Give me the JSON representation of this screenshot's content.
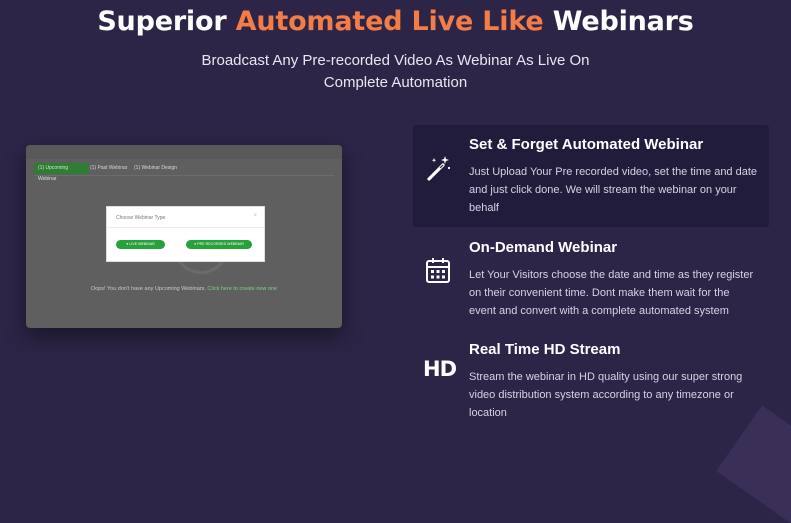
{
  "hero": {
    "title_part1": "Superior ",
    "title_accent": "Automated Live Like",
    "title_part2": " Webinars",
    "subtitle_line1": "Broadcast Any Pre-recorded Video As Webinar As Live On",
    "subtitle_line2": "Complete Automation",
    "accent_color": "#f47c46"
  },
  "preview": {
    "tabs": [
      "(1) Upcoming Webinar",
      "(1) Past Webinar",
      "(1) Webinar Design"
    ],
    "empty_message": "Oops! You don't have any Upcoming Webinars.",
    "empty_link": "Click here to create new one",
    "modal": {
      "title": "Choose Webinar Type",
      "close": "×",
      "buttons": [
        "LIVE WEBINAR",
        "PRE RECORDED WEBINAR"
      ]
    }
  },
  "features": [
    {
      "icon": "magic-wand-icon",
      "title": "Set & Forget Automated Webinar",
      "lines": [
        "Just Upload Your Pre recorded video, set the time and date",
        "and just click done. We will stream the webinar on your",
        "behalf"
      ]
    },
    {
      "icon": "calendar-icon",
      "title": "On-Demand Webinar",
      "lines": [
        "Let Your Visitors choose the date and time as they register",
        "on their convenient time. Dont make them wait for the",
        "event and convert with a complete automated system"
      ]
    },
    {
      "icon": "hd-icon",
      "icon_text": "HD",
      "title": "Real Time HD Stream",
      "lines": [
        "Stream the webinar in HD quality using our super strong",
        "video distribution system according to any timezone or",
        "location"
      ]
    }
  ]
}
